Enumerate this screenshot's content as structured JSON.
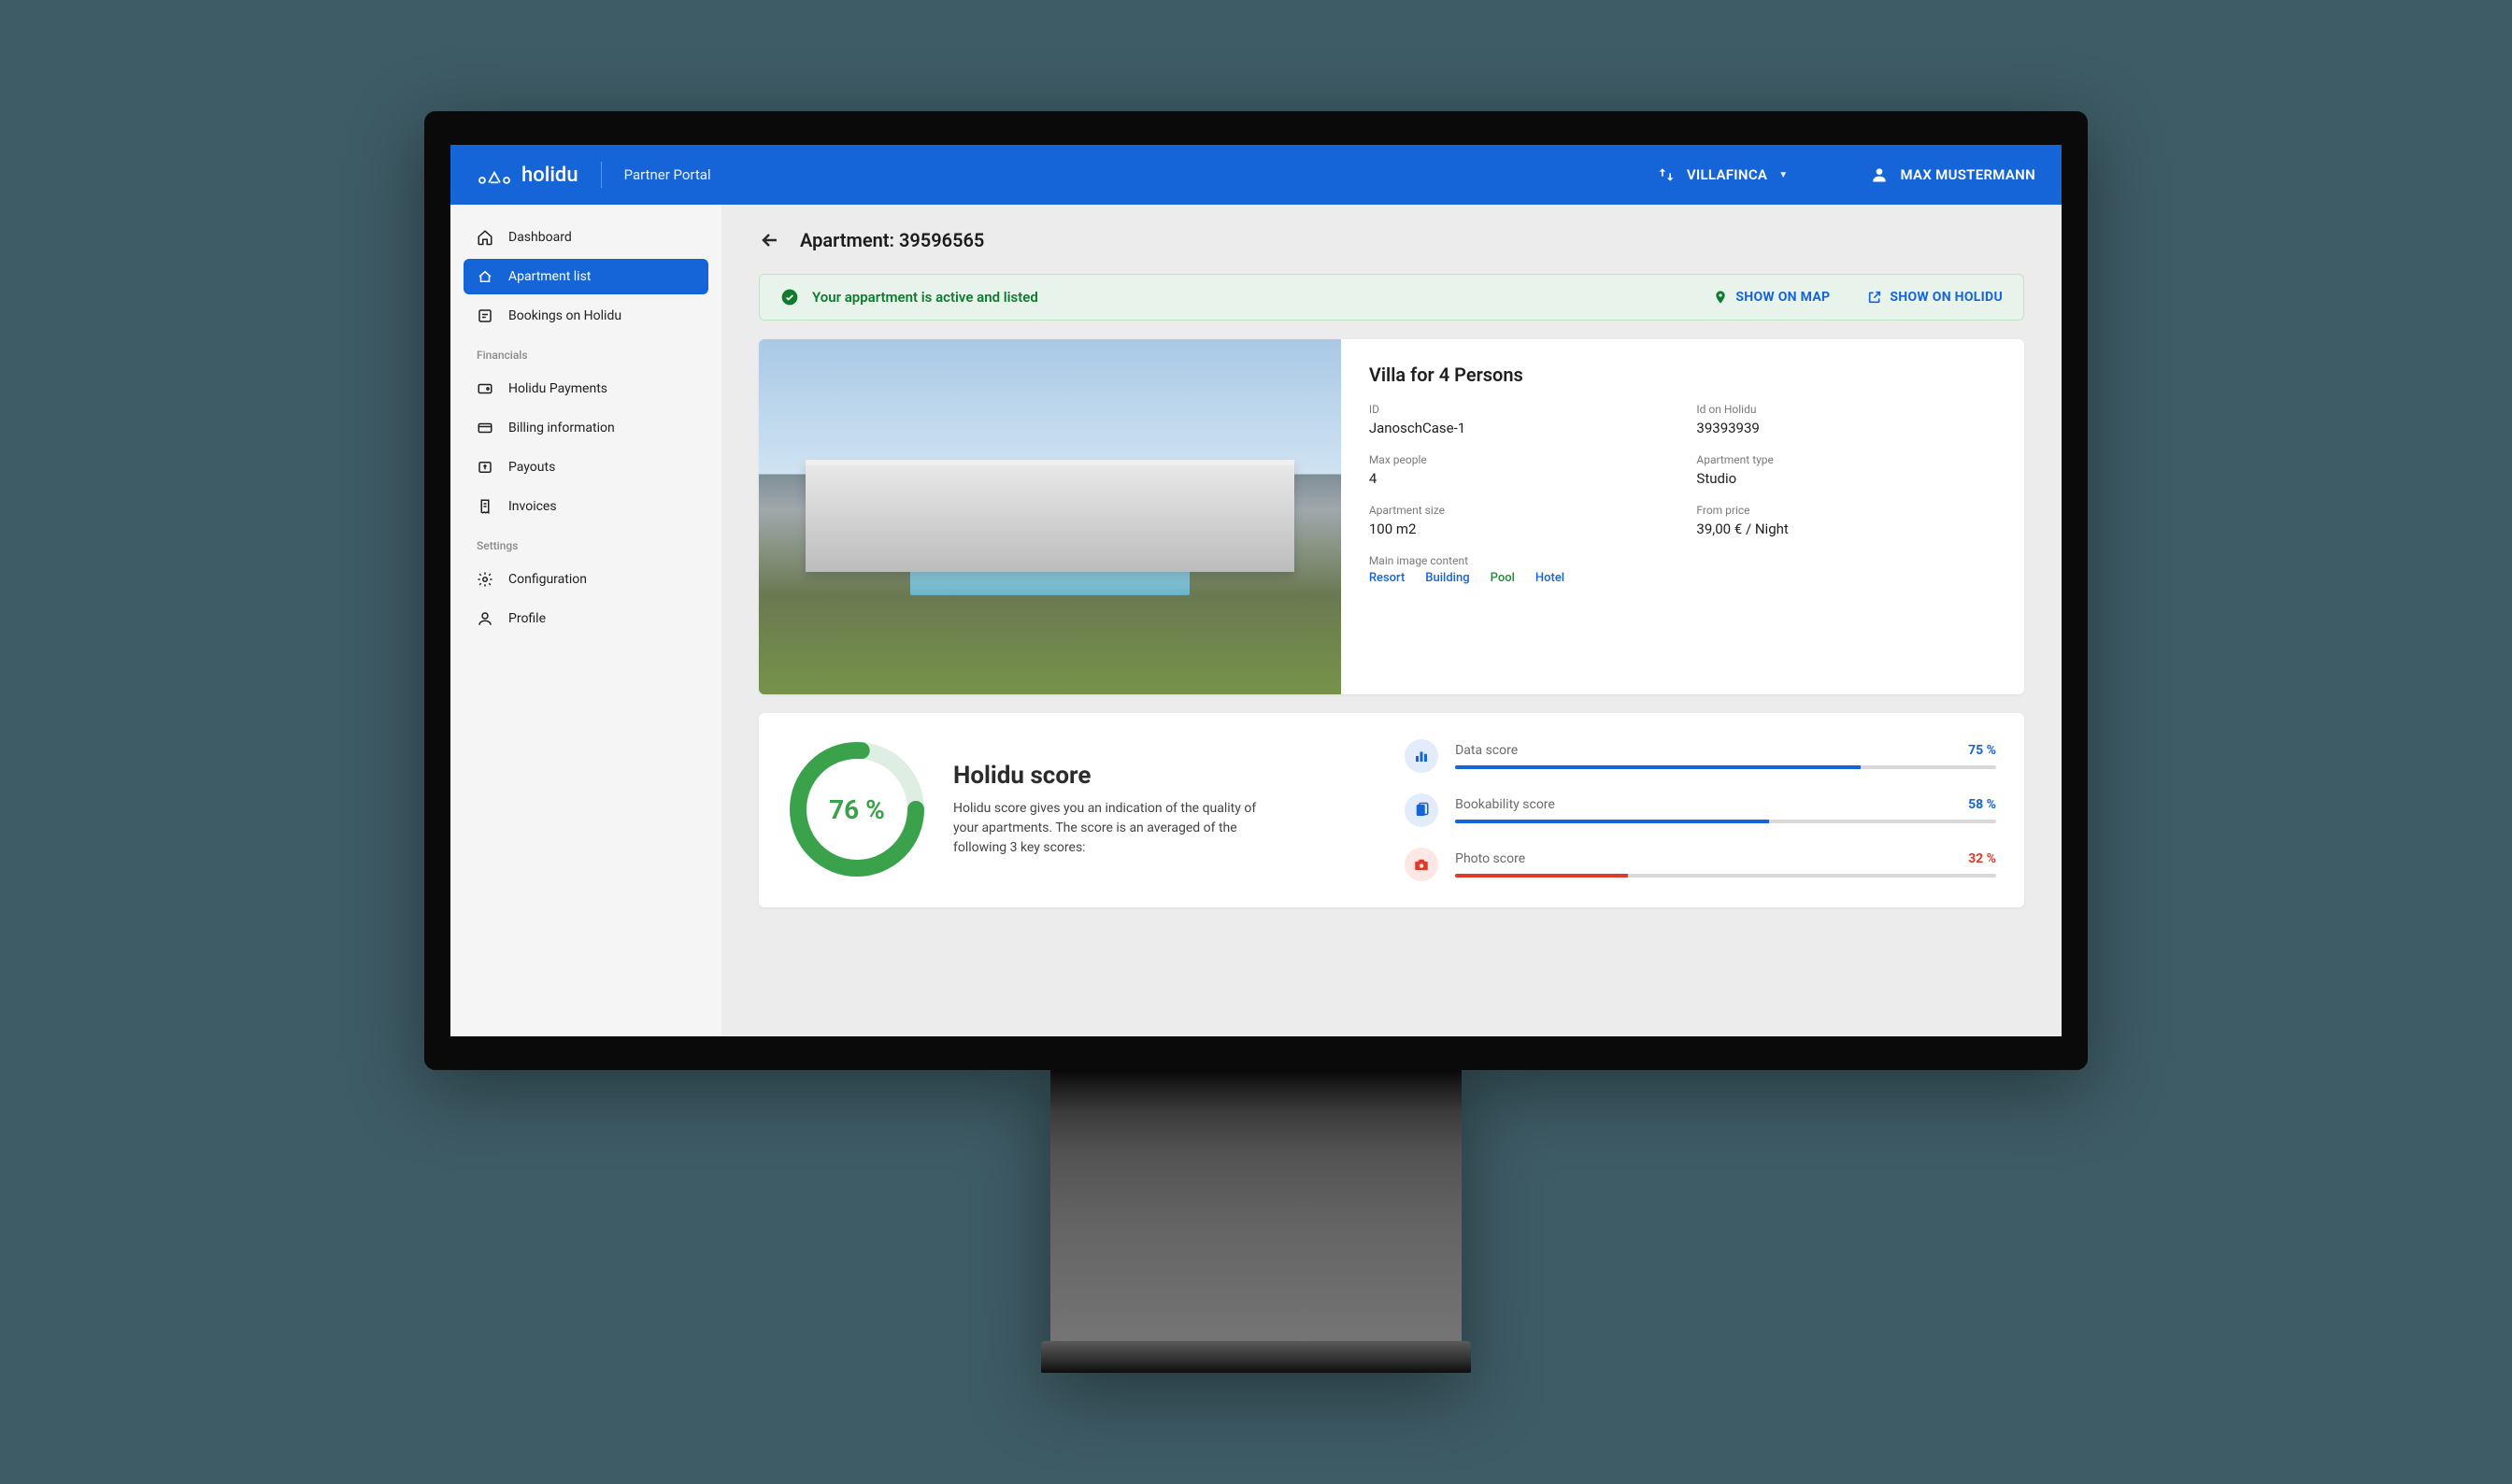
{
  "header": {
    "brand": "holidu",
    "portal": "Partner Portal",
    "org": "VILLAFINCA",
    "user": "MAX MUSTERMANN"
  },
  "sidebar": {
    "items": [
      {
        "label": "Dashboard"
      },
      {
        "label": "Apartment list"
      },
      {
        "label": "Bookings on Holidu"
      }
    ],
    "section_financials": "Financials",
    "financials": [
      {
        "label": "Holidu Payments"
      },
      {
        "label": "Billing information"
      },
      {
        "label": "Payouts"
      },
      {
        "label": "Invoices"
      }
    ],
    "section_settings": "Settings",
    "settings": [
      {
        "label": "Configuration"
      },
      {
        "label": "Profile"
      }
    ]
  },
  "page": {
    "title": "Apartment: 39596565"
  },
  "banner": {
    "message": "Your appartment is active and listed",
    "show_on_map": "SHOW ON MAP",
    "show_on_holidu": "SHOW ON HOLIDU"
  },
  "hero": {
    "title": "Villa for 4 Persons",
    "fields": {
      "id": {
        "label": "ID",
        "value": "JanoschCase-1"
      },
      "holidu_id": {
        "label": "Id on Holidu",
        "value": "39393939"
      },
      "max_people": {
        "label": "Max people",
        "value": "4"
      },
      "apt_type": {
        "label": "Apartment type",
        "value": "Studio"
      },
      "apt_size": {
        "label": "Apartment size",
        "value": "100 m2"
      },
      "from_price": {
        "label": "From price",
        "value": "39,00 € / Night"
      }
    },
    "image_content_label": "Main image content",
    "tags": [
      {
        "text": "Resort",
        "cls": "blue"
      },
      {
        "text": "Building",
        "cls": "blue"
      },
      {
        "text": "Pool",
        "cls": "green"
      },
      {
        "text": "Hotel",
        "cls": "blue"
      }
    ]
  },
  "score": {
    "overall_pct": 76,
    "overall_label": "76 %",
    "title": "Holidu score",
    "description": "Holidu score gives you an indication of the quality of your apartments. The score is an averaged of the following 3 key scores:",
    "rows": [
      {
        "name": "Data score",
        "pct": 75,
        "display": "75 %",
        "tone": "blue",
        "icon": "bar"
      },
      {
        "name": "Bookability score",
        "pct": 58,
        "display": "58 %",
        "tone": "blue",
        "icon": "book"
      },
      {
        "name": "Photo score",
        "pct": 32,
        "display": "32 %",
        "tone": "red",
        "icon": "camera"
      }
    ]
  }
}
